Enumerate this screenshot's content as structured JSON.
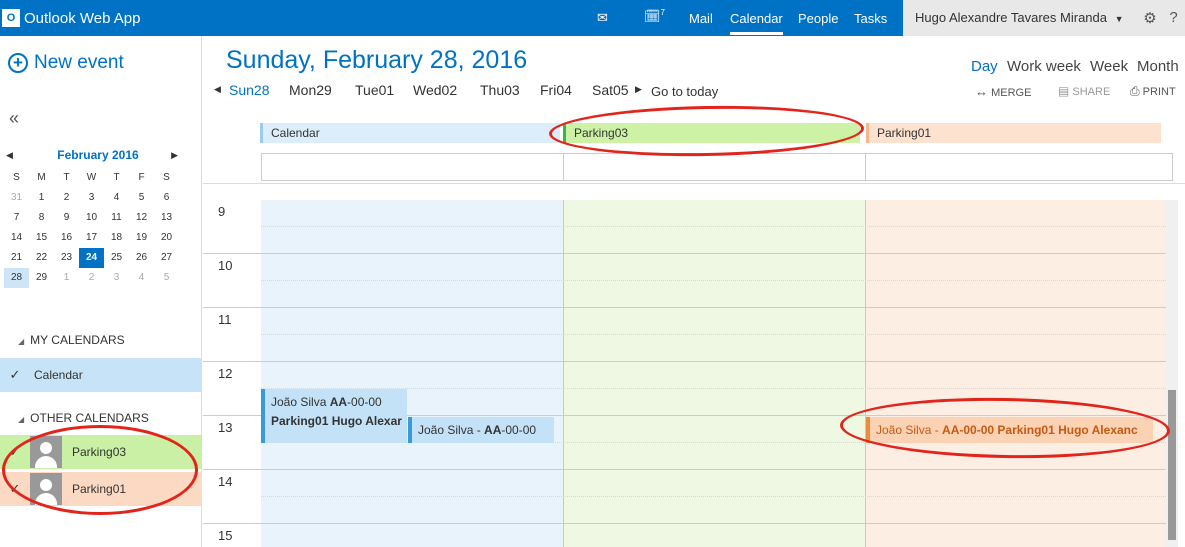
{
  "app": {
    "title": "Outlook Web App",
    "logo": "O"
  },
  "topnav": {
    "mail_badge": "",
    "calendar_badge": "7",
    "links": [
      "Mail",
      "Calendar",
      "People",
      "Tasks"
    ],
    "active": "Calendar",
    "user": "Hugo Alexandre Tavares Miranda",
    "icons": [
      "mail-icon",
      "calendar-icon",
      "gear-icon",
      "help-icon"
    ]
  },
  "left": {
    "new_event": "New event",
    "collapse": "«",
    "minical": {
      "month": "February 2016",
      "dow": [
        "S",
        "M",
        "T",
        "W",
        "T",
        "F",
        "S"
      ],
      "weeks": [
        [
          "31",
          "1",
          "2",
          "3",
          "4",
          "5",
          "6"
        ],
        [
          "7",
          "8",
          "9",
          "10",
          "11",
          "12",
          "13"
        ],
        [
          "14",
          "15",
          "16",
          "17",
          "18",
          "19",
          "20"
        ],
        [
          "21",
          "22",
          "23",
          "24",
          "25",
          "26",
          "27"
        ],
        [
          "28",
          "29",
          "1",
          "2",
          "3",
          "4",
          "5"
        ]
      ],
      "today": "24",
      "selected": "28"
    },
    "my_calendars_title": "MY CALENDARS",
    "my_calendars": [
      {
        "name": "Calendar",
        "checked": true,
        "color": "#c7e3f8"
      }
    ],
    "other_calendars_title": "OTHER CALENDARS",
    "other_calendars": [
      {
        "name": "Parking03",
        "checked": true,
        "color": "#c9f0a4"
      },
      {
        "name": "Parking01",
        "checked": true,
        "color": "#fcd9c2"
      }
    ]
  },
  "main": {
    "date_title": "Sunday, February 28, 2016",
    "days": [
      "Sun28",
      "Mon29",
      "Tue01",
      "Wed02",
      "Thu03",
      "Fri04",
      "Sat05"
    ],
    "active_day": "Sun28",
    "go_to_today": "Go to today",
    "views": [
      "Day",
      "Work week",
      "Week",
      "Month"
    ],
    "active_view": "Day",
    "actions": {
      "merge": "MERGE",
      "share": "SHARE",
      "print": "PRINT"
    },
    "hours": [
      "9",
      "10",
      "11",
      "12",
      "13",
      "14",
      "15"
    ],
    "columns": [
      {
        "name": "Calendar",
        "head_color": "#dceefb",
        "body_color": "#e8f3fc",
        "bar_color": "#9ccbee"
      },
      {
        "name": "Parking03",
        "head_color": "#cdf2a6",
        "body_color": "#eef8e2",
        "bar_color": "#3cb54a"
      },
      {
        "name": "Parking01",
        "head_color": "#fde2d0",
        "body_color": "#fdeee4",
        "bar_color": "#f7b58c"
      }
    ],
    "events": [
      {
        "column": 0,
        "line1_plain": "João Silva ",
        "line1_bold": "AA",
        "line1_rest": "-00-00",
        "line2": "Parking01 Hugo Alexar",
        "color": "#c3e2f8",
        "bar": "#3a9ad9"
      },
      {
        "column": 0,
        "text_plain": "João Silva - ",
        "text_bold": "AA",
        "text_rest": "-00-00",
        "color": "#c3e2f8",
        "bar": "#3a9ad9"
      },
      {
        "column": 2,
        "text_plain": "João Silva - ",
        "text_bold": "AA",
        "text_rest": "-00-00 Parking01 Hugo Alexanc",
        "color": "#fcd2b5",
        "bar": "#f08a3c",
        "text_color": "#c55a11"
      }
    ]
  },
  "annotation_color": "#e3241b"
}
